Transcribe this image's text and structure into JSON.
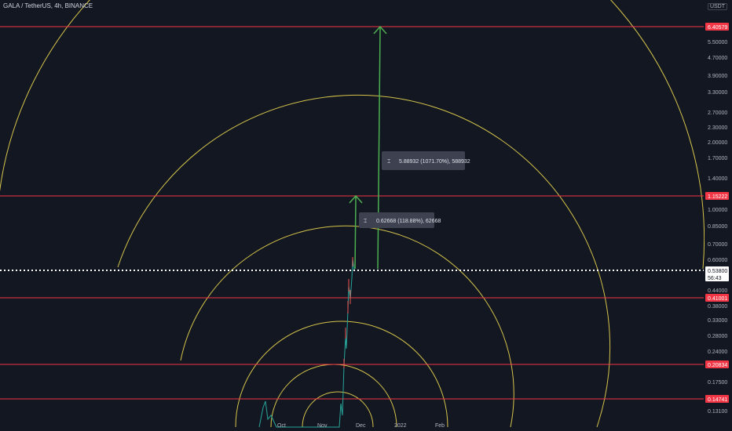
{
  "header": {
    "symbol": "GALA / TetherUS, 4h, BINANCE",
    "currency": "USDT"
  },
  "chart_data": {
    "type": "line",
    "title": "GALA / TetherUS, 4h, BINANCE",
    "y_scale": "log",
    "y_tick_labels": [
      "6.40579",
      "5.50000",
      "4.70000",
      "3.90000",
      "3.30000",
      "2.70000",
      "2.30000",
      "2.00000",
      "1.70000",
      "1.40000",
      "1.15222",
      "1.00000",
      "0.85000",
      "0.70000",
      "0.60000",
      "0.53800",
      "0.44000",
      "0.41001",
      "0.38000",
      "0.33000",
      "0.28000",
      "0.24000",
      "0.20834",
      "0.17500",
      "0.14741",
      "0.13100"
    ],
    "x_tick_labels": [
      "Oct",
      "Nov",
      "Dec",
      "2022",
      "Feb"
    ],
    "levels": [
      {
        "value": "6.40579",
        "color": "#f23645"
      },
      {
        "value": "1.15222",
        "color": "#f23645"
      },
      {
        "value": "0.41001",
        "color": "#f23645"
      },
      {
        "value": "0.20834",
        "color": "#f23645"
      },
      {
        "value": "0.14741",
        "color": "#f23645"
      }
    ],
    "current_price": {
      "value": "0.53800",
      "countdown": "56:43",
      "color": "#ffffff"
    },
    "annotations": [
      {
        "text": "5.88932 (1071.70%), 588932"
      },
      {
        "text": "0.62668 (118.88%), 62668"
      }
    ],
    "arc_color": "#d4c34a",
    "arrow_color": "#4caf50",
    "grid": false
  }
}
